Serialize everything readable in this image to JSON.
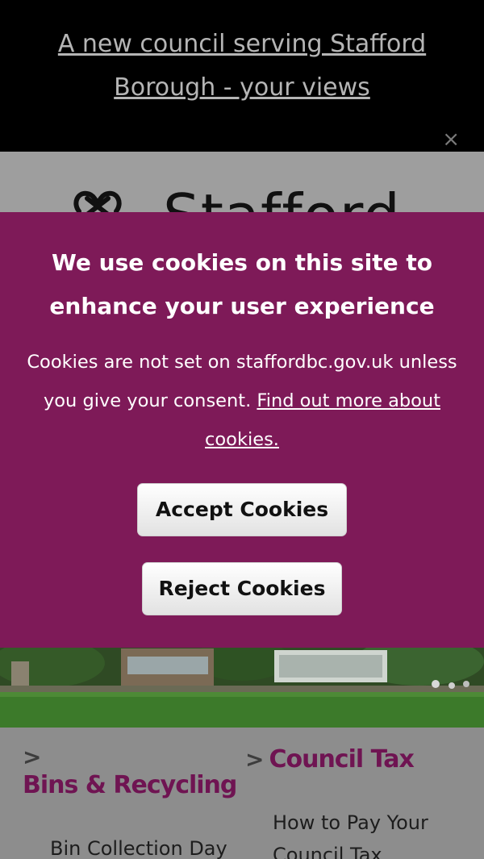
{
  "banner": {
    "link_text": "A new council serving Stafford Borough - your views",
    "close_glyph": "×"
  },
  "header": {
    "logo_text": "Stafford",
    "logo_icon": "stafford-knot-icon"
  },
  "cookie_banner": {
    "title": "We use cookies on this site to enhance your user experience",
    "body_text": "Cookies are not set on staffordbc.gov.uk unless you give your consent.",
    "link_text": "Find out more about cookies.",
    "accept_label": "Accept Cookies",
    "reject_label": "Reject Cookies",
    "background_color": "#7e1a58"
  },
  "categories": [
    {
      "title": "Bins & Recycling",
      "chevron_icon": "chevron-right-icon",
      "links": [
        "Bin Collection Day"
      ]
    },
    {
      "title": "Council Tax",
      "chevron_icon": "chevron-right-icon",
      "links": [
        "How to Pay Your Council Tax"
      ]
    }
  ],
  "colors": {
    "brand": "#6f1452",
    "banner_bg": "#000000"
  }
}
